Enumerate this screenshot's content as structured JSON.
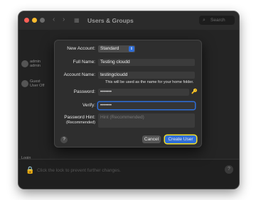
{
  "window": {
    "title": "Users & Groups",
    "search_placeholder": "Search",
    "sidebar": [
      {
        "label": "admin admin"
      },
      {
        "label": "Guest User Off"
      },
      {
        "label": "Login Options"
      }
    ],
    "lock_text": "Click the lock to prevent further changes.",
    "help": "?"
  },
  "sheet": {
    "new_account_label": "New Account:",
    "new_account_value": "Standard",
    "full_name_label": "Full Name:",
    "full_name_value": "Testing cloudd",
    "account_name_label": "Account Name:",
    "account_name_value": "testingcloudd",
    "account_name_hint": "This will be used as the name for your home folder.",
    "password_label": "Password:",
    "password_value": "•••••••",
    "verify_label": "Verify:",
    "verify_value": "•••••••",
    "hint_label": "Password Hint:",
    "hint_sublabel": "(Recommended)",
    "hint_placeholder": "Hint (Recommended)",
    "help": "?",
    "cancel_label": "Cancel",
    "create_label": "Create User",
    "accent": "#2f6ed8",
    "highlight": "#f2df2a"
  }
}
